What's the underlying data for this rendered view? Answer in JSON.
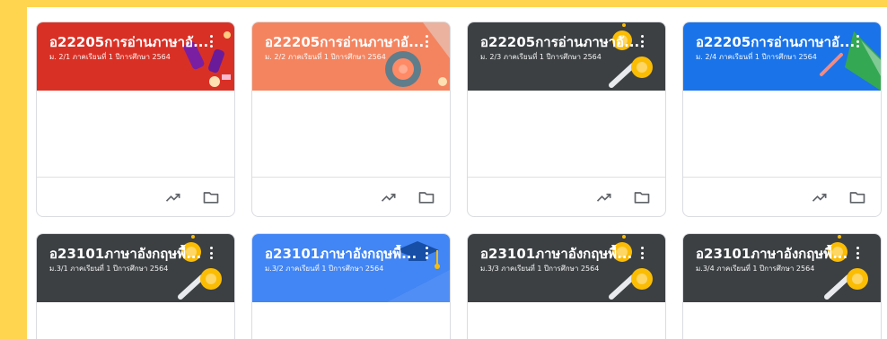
{
  "classes": [
    {
      "title": "อ22205การอ่านภาษาอั...",
      "subtitle": "ม. 2/1 ภาคเรียนที่ 1 ปีการศึกษา 2564",
      "theme": "red",
      "color": "#d93025"
    },
    {
      "title": "อ22205การอ่านภาษาอั...",
      "subtitle": "ม. 2/2 ภาคเรียนที่ 1 ปีการศึกษา 2564",
      "theme": "coral",
      "color": "#f4845f"
    },
    {
      "title": "อ22205การอ่านภาษาอั...",
      "subtitle": "ม. 2/3 ภาคเรียนที่ 1 ปีการศึกษา 2564",
      "theme": "dark",
      "color": "#3c4043"
    },
    {
      "title": "อ22205การอ่านภาษาอั...",
      "subtitle": "ม. 2/4 ภาคเรียนที่ 1 ปีการศึกษา 2564",
      "theme": "blue",
      "color": "#1a73e8"
    },
    {
      "title": "อ23101ภาษาอังกฤษพื้...",
      "subtitle": "ม.3/1 ภาคเรียนที่ 1 ปีการศึกษา 2564",
      "theme": "dark",
      "color": "#3c4043"
    },
    {
      "title": "อ23101ภาษาอังกฤษพื้...",
      "subtitle": "ม.3/2 ภาคเรียนที่ 1 ปีการศึกษา 2564",
      "theme": "royal",
      "color": "#4285f4"
    },
    {
      "title": "อ23101ภาษาอังกฤษพื้...",
      "subtitle": "ม.3/3 ภาคเรียนที่ 1 ปีการศึกษา 2564",
      "theme": "dark",
      "color": "#3c4043"
    },
    {
      "title": "อ23101ภาษาอังกฤษพื้...",
      "subtitle": "ม.3/4 ภาคเรียนที่ 1 ปีการศึกษา 2564",
      "theme": "dark",
      "color": "#3c4043"
    }
  ],
  "card_actions": {
    "primary_icon": "trending-up-icon",
    "secondary_icon": "folder-icon"
  },
  "colors": {
    "page_background": "#ffd54f",
    "icon_gray": "#5f6368",
    "card_border": "#dadce0"
  }
}
